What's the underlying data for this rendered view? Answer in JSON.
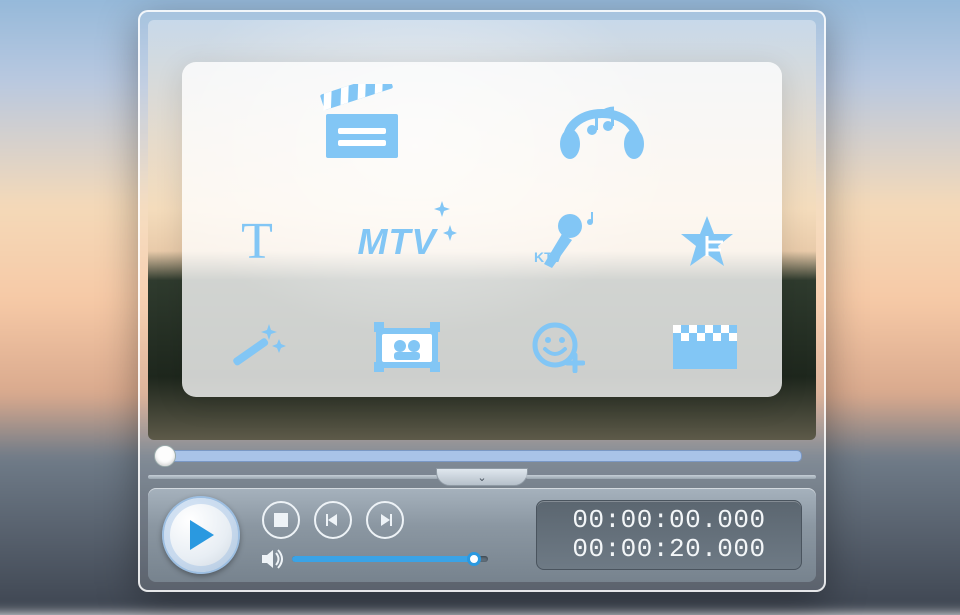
{
  "colors": {
    "icon_blue": "#82c6f5",
    "play_blue": "#2a99e0"
  },
  "tools": {
    "clapper": "clapper-icon",
    "headphones": "headphones-icon",
    "text": "text-icon",
    "mtv": "MTV",
    "ktv": "KTV",
    "star": "star-icon",
    "wand": "wand-icon",
    "frame": "frame-icon",
    "emoji_add": "emoji-add-icon",
    "mosaic": "mosaic-icon"
  },
  "collapse_glyph": "⌄",
  "playback": {
    "current": "00:00:00.000",
    "total": "00:00:20.000"
  },
  "volume": {
    "level": 0.93
  },
  "scrub": {
    "position": 0.0
  }
}
